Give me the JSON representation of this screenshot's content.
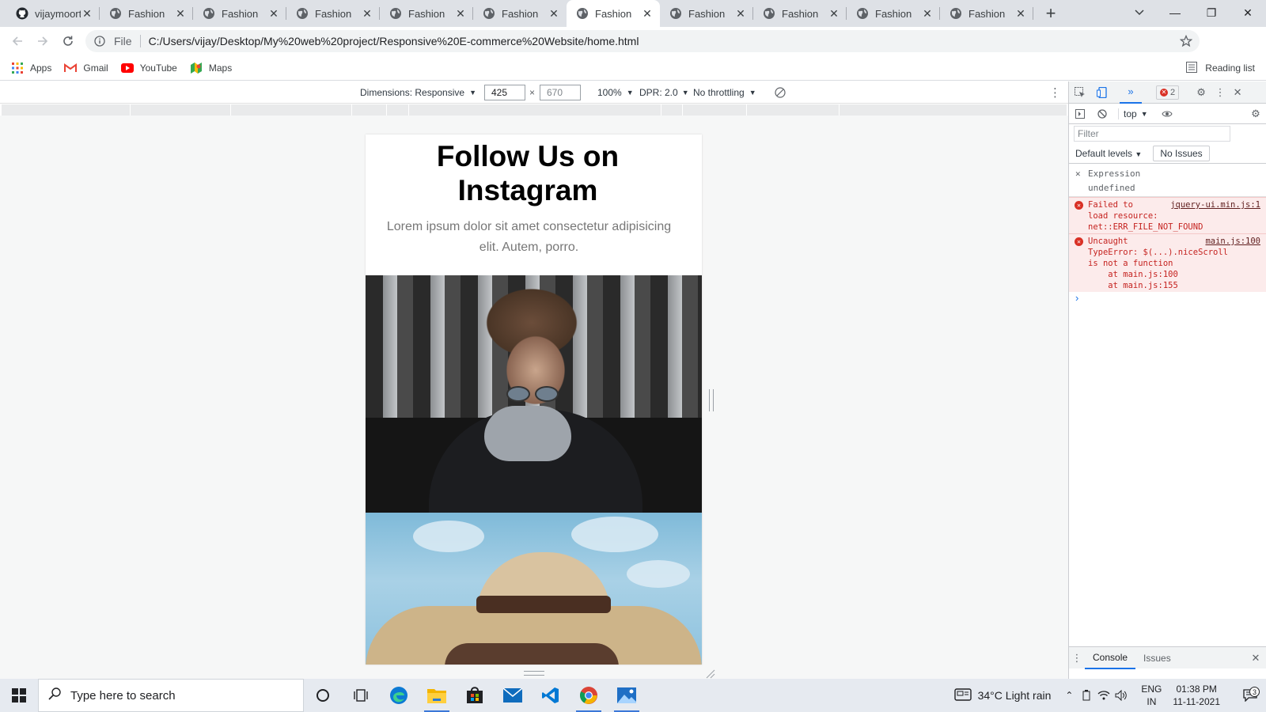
{
  "browser": {
    "tabs": [
      {
        "title": "vijaymoorthi",
        "favicon": "github-icon",
        "active": false
      },
      {
        "title": "Fashion",
        "favicon": "globe-icon",
        "active": false
      },
      {
        "title": "Fashion",
        "favicon": "globe-icon",
        "active": false
      },
      {
        "title": "Fashion",
        "favicon": "globe-icon",
        "active": false
      },
      {
        "title": "Fashion",
        "favicon": "globe-icon",
        "active": false
      },
      {
        "title": "Fashion",
        "favicon": "globe-icon",
        "active": false
      },
      {
        "title": "Fashion",
        "favicon": "globe-icon",
        "active": true
      },
      {
        "title": "Fashion",
        "favicon": "globe-icon",
        "active": false
      },
      {
        "title": "Fashion",
        "favicon": "globe-icon",
        "active": false
      },
      {
        "title": "Fashion",
        "favicon": "globe-icon",
        "active": false
      },
      {
        "title": "Fashion",
        "favicon": "globe-icon",
        "active": false
      }
    ],
    "address": {
      "scheme_label": "File",
      "url": "C:/Users/vijay/Desktop/My%20web%20project/Responsive%20E-commerce%20Website/home.html"
    },
    "bookmarks": [
      {
        "label": "Apps",
        "icon": "apps-grid-icon"
      },
      {
        "label": "Gmail",
        "icon": "gmail-icon"
      },
      {
        "label": "YouTube",
        "icon": "youtube-icon"
      },
      {
        "label": "Maps",
        "icon": "maps-icon"
      }
    ],
    "reading_list": "Reading list"
  },
  "device_toolbar": {
    "dimensions_label": "Dimensions: Responsive",
    "width": "425",
    "times": "×",
    "height": "670",
    "zoom": "100%",
    "dpr": "DPR: 2.0",
    "throttling": "No throttling"
  },
  "page": {
    "heading": "Follow Us on Instagram",
    "subtext": "Lorem ipsum dolor sit amet consectetur adipisicing elit. Autem, porro."
  },
  "devtools": {
    "error_count": "2",
    "context": "top",
    "filter_placeholder": "Filter",
    "levels": "Default levels",
    "issues": "No Issues",
    "expression_label": "Expression",
    "expression_value": "undefined",
    "errors": [
      {
        "text": "Failed to\nload resource:\nnet::ERR_FILE_NOT_FOUND",
        "source": "jquery-ui.min.js:1"
      },
      {
        "text": "Uncaught\nTypeError: $(...).niceScroll\nis not a function\n    at main.js:100\n    at main.js:155",
        "source": "main.js:100"
      }
    ],
    "drawer_tabs": [
      "Console",
      "Issues"
    ]
  },
  "taskbar": {
    "search_placeholder": "Type here to search",
    "weather": "34°C  Light rain",
    "lang_line1": "ENG",
    "lang_line2": "IN",
    "time": "01:38 PM",
    "date": "11-11-2021",
    "notification_count": "3"
  }
}
